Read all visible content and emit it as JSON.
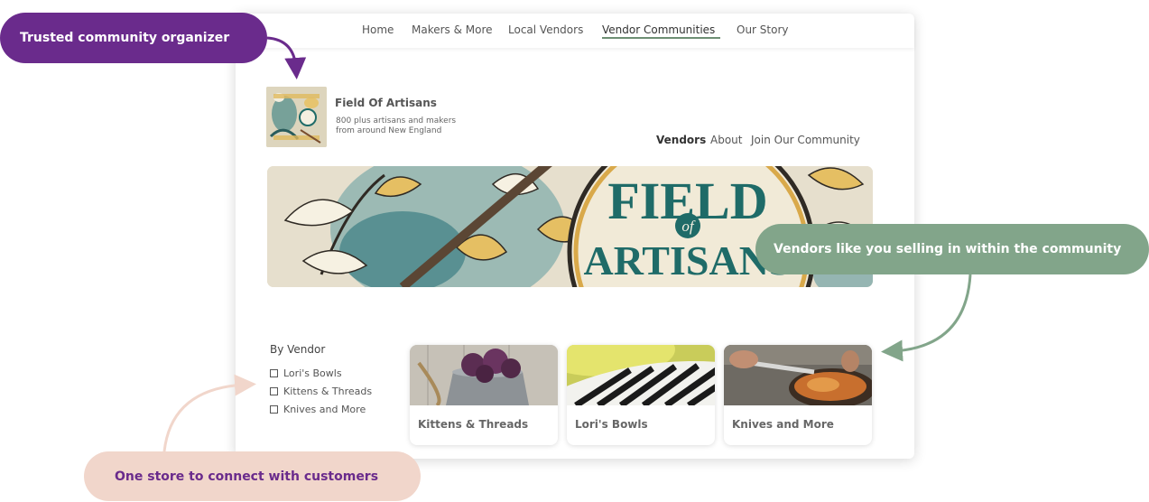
{
  "nav": {
    "items": [
      "Home",
      "Makers & More",
      "Local Vendors",
      "Vendor Communities",
      "Our Story"
    ],
    "active": "Vendor Communities"
  },
  "community": {
    "name": "Field Of Artisans",
    "description_line1": "800 plus  artisans and makers",
    "description_line2": "from around New England",
    "logo_text": "FIELD of ARTISANS",
    "subnav": [
      "Vendors",
      "About",
      "Join Our Community"
    ],
    "subnav_active": "Vendors"
  },
  "banner": {
    "line1": "FIELD",
    "line2": "of",
    "line3": "ARTISANS"
  },
  "filter": {
    "title": "By Vendor",
    "options": [
      "Lori's Bowls",
      "Kittens & Threads",
      "Knives and More"
    ]
  },
  "vendors": [
    {
      "name": "Kittens & Threads"
    },
    {
      "name": "Lori's Bowls"
    },
    {
      "name": "Knives and More"
    }
  ],
  "callouts": {
    "organizer": "Trusted community organizer",
    "vendors": "Vendors like you selling in within the community",
    "store": "One  store to connect with customers"
  },
  "colors": {
    "purple": "#6a2b8c",
    "green": "#82a58a",
    "peach": "#f1d6cb",
    "teal_text": "#1f6b68"
  }
}
